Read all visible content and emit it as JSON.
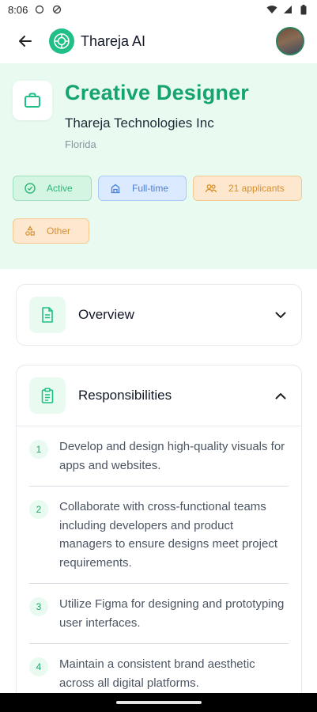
{
  "status_bar": {
    "time": "8:06"
  },
  "app_bar": {
    "title": "Thareja AI"
  },
  "job": {
    "title": "Creative Designer",
    "company": "Thareja Technologies Inc",
    "location": "Florida"
  },
  "chips": {
    "status": "Active",
    "type": "Full-time",
    "applicants": "21 applicants",
    "category": "Other"
  },
  "sections": {
    "overview": "Overview",
    "responsibilities": "Responsibilities"
  },
  "responsibilities": [
    {
      "num": "1",
      "text": "Develop and design high-quality visuals for apps and websites."
    },
    {
      "num": "2",
      "text": "Collaborate with cross-functional teams including developers and product managers to ensure designs meet project requirements."
    },
    {
      "num": "3",
      "text": "Utilize Figma for designing and prototyping user interfaces."
    },
    {
      "num": "4",
      "text": "Maintain a consistent brand aesthetic across all digital platforms."
    }
  ],
  "colors": {
    "accent": "#15a36e",
    "hero_bg": "#e9fbf1"
  }
}
